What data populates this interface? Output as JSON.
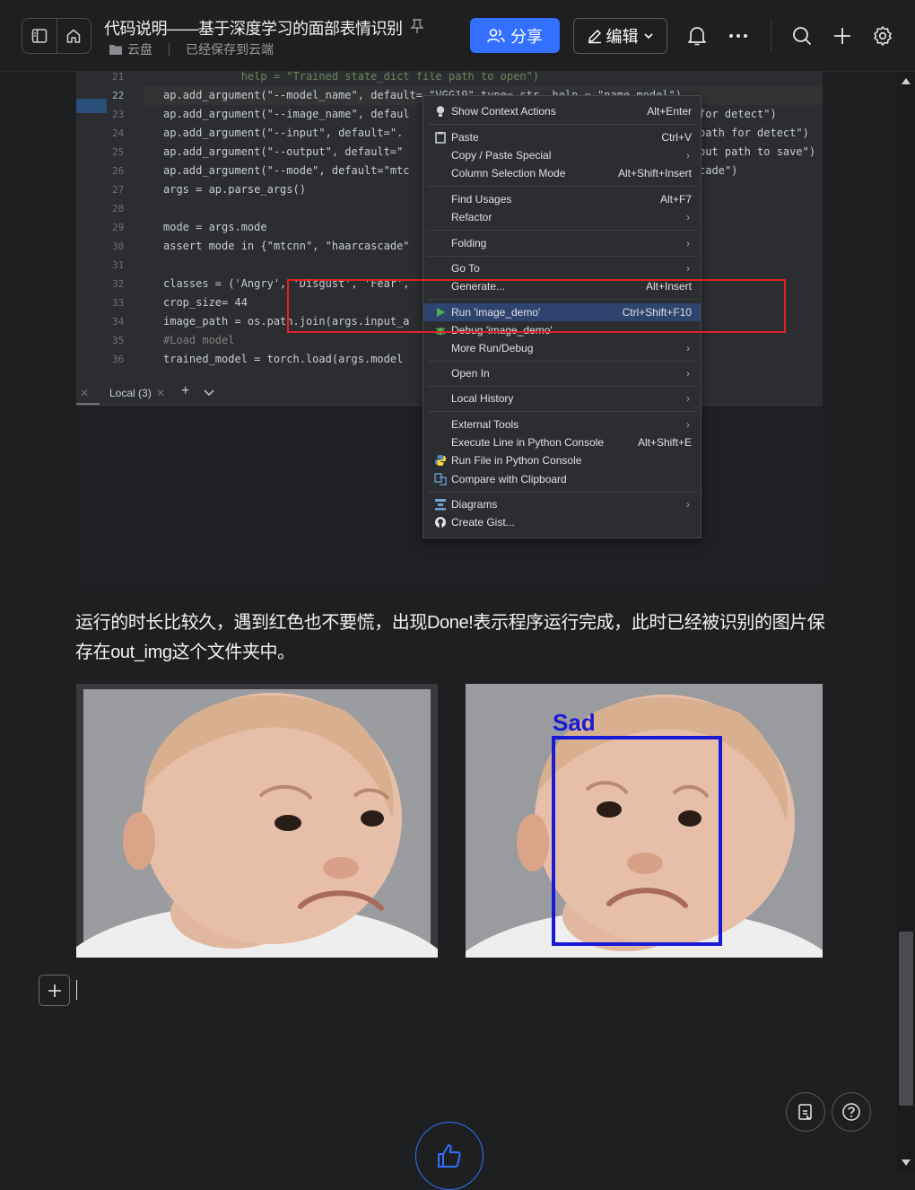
{
  "header": {
    "title": "代码说明——基于深度学习的面部表情识别",
    "location": "云盘",
    "save_status": "已经保存到云端",
    "share_label": "分享",
    "edit_label": "编辑"
  },
  "editor": {
    "lines": [
      {
        "n": "21",
        "code": "            help = \"Trained state_dict file path to open\")"
      },
      {
        "n": "22",
        "code": "ap.add_argument(\"--model_name\", default= \"VGG19\" type= str  help = \"name model\")"
      },
      {
        "n": "23",
        "code": "ap.add_argument(\"--image_name\", defaul"
      },
      {
        "n": "24",
        "code": "ap.add_argument(\"--input\", default=\"."
      },
      {
        "n": "25",
        "code": "ap.add_argument(\"--output\", default=\""
      },
      {
        "n": "26",
        "code": "ap.add_argument(\"--mode\", default=\"mtc"
      },
      {
        "n": "27",
        "code": "args = ap.parse_args()"
      },
      {
        "n": "28",
        "code": ""
      },
      {
        "n": "29",
        "code": "mode = args.mode"
      },
      {
        "n": "30",
        "code": "assert mode in {\"mtcnn\", \"haarcascade\""
      },
      {
        "n": "31",
        "code": ""
      },
      {
        "n": "32",
        "code": "classes = ('Angry', 'Disgust', 'Fear',"
      },
      {
        "n": "33",
        "code": "crop_size= 44"
      },
      {
        "n": "34",
        "code": "image_path = os.path.join(args.input_a"
      },
      {
        "n": "35",
        "code": "#Load model"
      },
      {
        "n": "36",
        "code": "trained_model = torch.load(args.model"
      }
    ],
    "right_fragments": [
      "for detect\")",
      "path for detect\")",
      "put path to save\")",
      "cade\")"
    ],
    "panel_tab": "Local (3)"
  },
  "context_menu": {
    "items": [
      {
        "label": "Show Context Actions",
        "shortcut": "Alt+Enter"
      },
      {
        "label": "Paste",
        "shortcut": "Ctrl+V"
      },
      {
        "label": "Copy / Paste Special",
        "shortcut": ""
      },
      {
        "label": "Column Selection Mode",
        "shortcut": "Alt+Shift+Insert"
      },
      {
        "label": "Find Usages",
        "shortcut": "Alt+F7"
      },
      {
        "label": "Refactor",
        "shortcut": ""
      },
      {
        "label": "Folding",
        "shortcut": ""
      },
      {
        "label": "Go To",
        "shortcut": ""
      },
      {
        "label": "Generate...",
        "shortcut": "Alt+Insert"
      },
      {
        "label": "Run 'image_demo'",
        "shortcut": "Ctrl+Shift+F10"
      },
      {
        "label": "Debug 'image_demo'",
        "shortcut": ""
      },
      {
        "label": "More Run/Debug",
        "shortcut": ""
      },
      {
        "label": "Open In",
        "shortcut": ""
      },
      {
        "label": "Local History",
        "shortcut": ""
      },
      {
        "label": "External Tools",
        "shortcut": ""
      },
      {
        "label": "Execute Line in Python Console",
        "shortcut": "Alt+Shift+E"
      },
      {
        "label": "Run File in Python Console",
        "shortcut": ""
      },
      {
        "label": "Compare with Clipboard",
        "shortcut": ""
      },
      {
        "label": "Diagrams",
        "shortcut": ""
      },
      {
        "label": "Create Gist...",
        "shortcut": ""
      }
    ]
  },
  "body": {
    "paragraph": "运行的时长比较久，遇到红色也不要慌，出现Done!表示程序运行完成，此时已经被识别的图片保存在out_img这个文件夹中。",
    "detection_label": "Sad"
  },
  "colors": {
    "accent": "#3370ff",
    "highlight_box": "#e0232b",
    "detection_box": "#1a1ad6"
  }
}
